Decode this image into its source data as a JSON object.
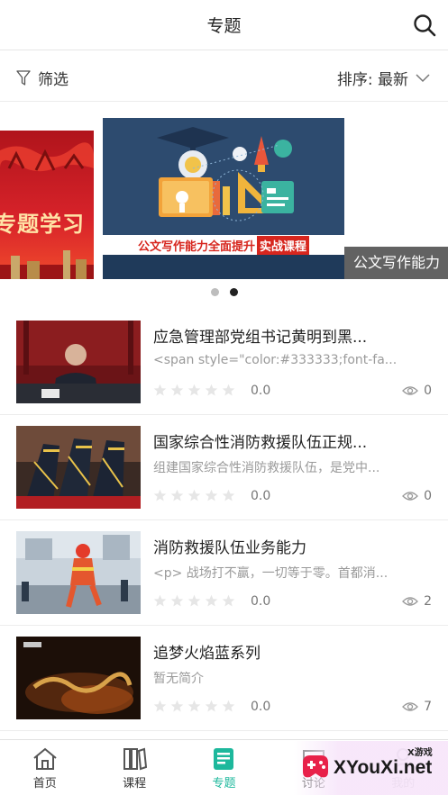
{
  "header": {
    "title": "专题",
    "search_icon": "search-icon"
  },
  "filter": {
    "label": "筛选",
    "sort_label": "排序: 最新"
  },
  "carousel": {
    "left_slide_text": "专题学习",
    "main_banner_text": "公文写作能力全面提升",
    "main_banner_highlight": "实战课程",
    "caption": "公文写作能力",
    "dot_count": 2,
    "active_dot": 2
  },
  "items": [
    {
      "title": "应急管理部党组书记黄明到黑...",
      "desc": "<span style=\"color:#333333;font-fa...",
      "score": "0.0",
      "views": "0",
      "rating": 0
    },
    {
      "title": "国家综合性消防救援队伍正规...",
      "desc": "组建国家综合性消防救援队伍，是党中...",
      "score": "0.0",
      "views": "0",
      "rating": 0
    },
    {
      "title": "消防救援队伍业务能力",
      "desc": "<p> 战场打不赢，一切等于零。首都消...",
      "score": "0.0",
      "views": "2",
      "rating": 0
    },
    {
      "title": "追梦火焰蓝系列",
      "desc": "暂无简介",
      "score": "0.0",
      "views": "7",
      "rating": 0
    }
  ],
  "tabs": [
    {
      "label": "首页",
      "icon": "home-icon"
    },
    {
      "label": "课程",
      "icon": "course-icon"
    },
    {
      "label": "专题",
      "icon": "topic-icon",
      "active": true
    },
    {
      "label": "讨论",
      "icon": "discussion-icon"
    },
    {
      "label": "我的",
      "icon": "profile-icon"
    }
  ],
  "watermark": {
    "text": "XYouXi.net",
    "small": "X游戏"
  },
  "colors": {
    "accent": "#1db89c",
    "star": "#e6e6e6"
  }
}
